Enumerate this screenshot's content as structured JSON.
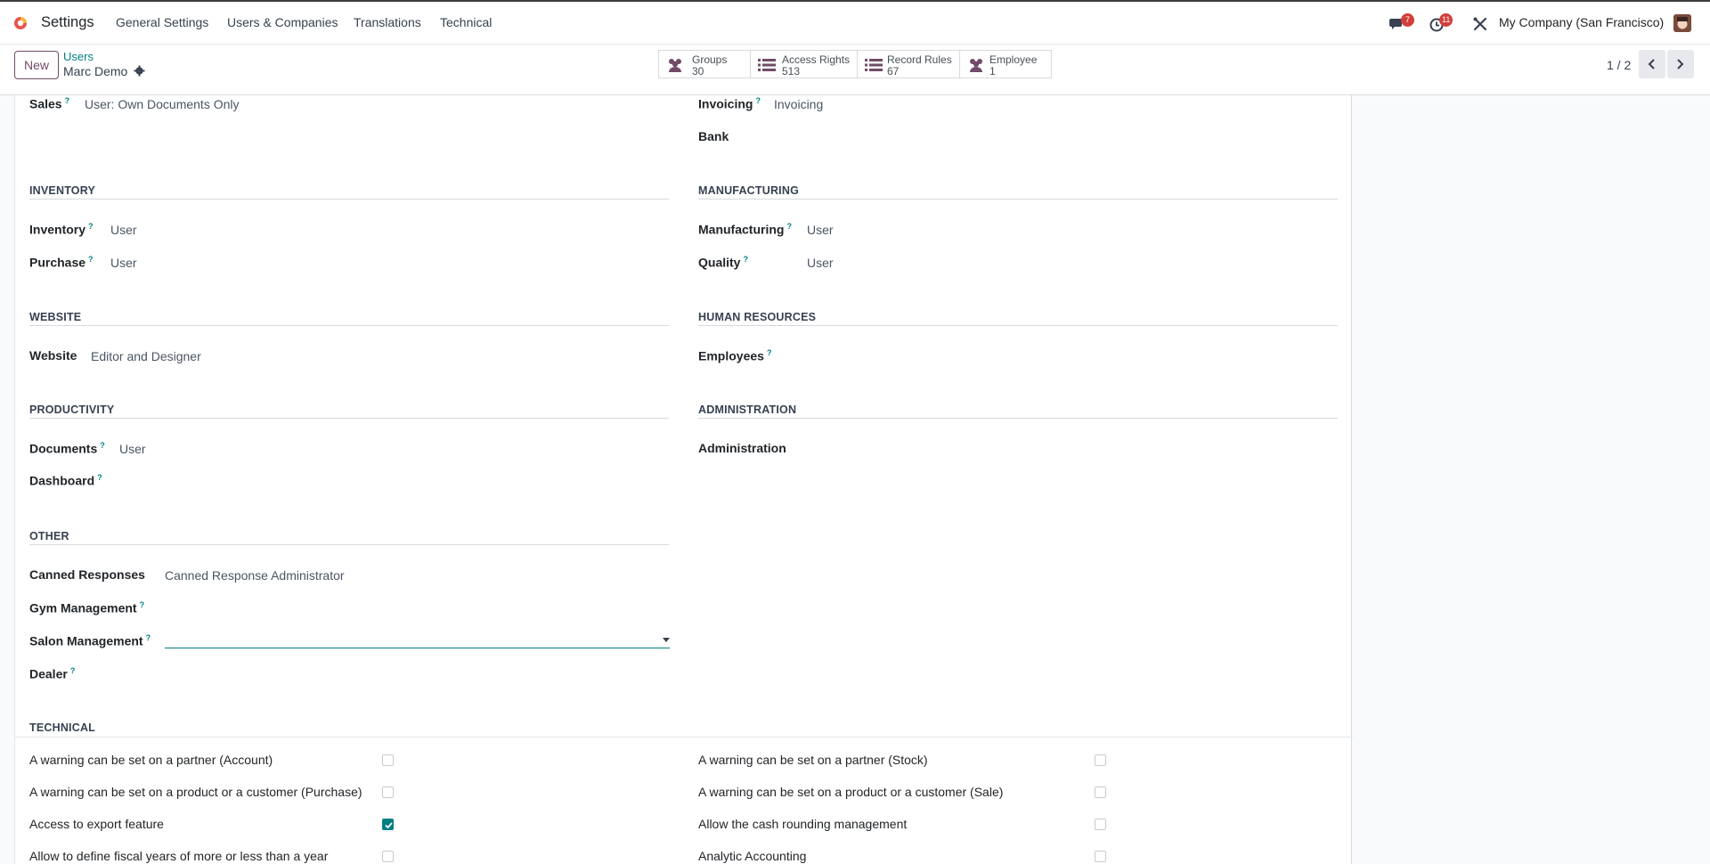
{
  "topbar": {
    "app_name": "Settings",
    "menu": [
      "General Settings",
      "Users & Companies",
      "Translations",
      "Technical"
    ],
    "messages_badge": "7",
    "activities_badge": "11",
    "company": "My Company (San Francisco)"
  },
  "control": {
    "new_label": "New",
    "breadcrumb_parent": "Users",
    "breadcrumb_current": "Marc Demo",
    "stats": [
      {
        "label": "Groups",
        "value": "30",
        "icon": "users-icon"
      },
      {
        "label": "Access Rights",
        "value": "513",
        "icon": "list-icon"
      },
      {
        "label": "Record Rules",
        "value": "67",
        "icon": "list-icon"
      },
      {
        "label": "Employee",
        "value": "1",
        "icon": "users-icon"
      }
    ],
    "pager": "1 / 2"
  },
  "form": {
    "sales": {
      "label": "Sales",
      "value": "User: Own Documents Only"
    },
    "invoicing": {
      "label": "Invoicing",
      "value": "Invoicing"
    },
    "bank": {
      "label": "Bank"
    },
    "inventory_section": "INVENTORY",
    "inventory": {
      "label": "Inventory",
      "value": "User"
    },
    "purchase": {
      "label": "Purchase",
      "value": "User"
    },
    "manufacturing_section": "MANUFACTURING",
    "manufacturing": {
      "label": "Manufacturing",
      "value": "User"
    },
    "quality": {
      "label": "Quality",
      "value": "User"
    },
    "website_section": "WEBSITE",
    "website": {
      "label": "Website",
      "value": "Editor and Designer"
    },
    "hr_section": "HUMAN RESOURCES",
    "employees": {
      "label": "Employees"
    },
    "productivity_section": "PRODUCTIVITY",
    "documents": {
      "label": "Documents",
      "value": "User"
    },
    "dashboard": {
      "label": "Dashboard"
    },
    "administration_section": "ADMINISTRATION",
    "administration": {
      "label": "Administration"
    },
    "other_section": "OTHER",
    "canned": {
      "label": "Canned Responses",
      "value": "Canned Response Administrator"
    },
    "gym": {
      "label": "Gym Management"
    },
    "salon": {
      "label": "Salon Management",
      "value": ""
    },
    "dealer": {
      "label": "Dealer"
    },
    "technical_section": "TECHNICAL",
    "technical": [
      {
        "label": "A warning can be set on a partner (Account)",
        "checked": false
      },
      {
        "label": "A warning can be set on a partner (Stock)",
        "checked": false
      },
      {
        "label": "A warning can be set on a product or a customer (Purchase)",
        "checked": false
      },
      {
        "label": "A warning can be set on a product or a customer (Sale)",
        "checked": false
      },
      {
        "label": "Access to export feature",
        "checked": true
      },
      {
        "label": "Allow the cash rounding management",
        "checked": false
      },
      {
        "label": "Allow to define fiscal years of more or less than a year",
        "checked": false
      },
      {
        "label": "Analytic Accounting",
        "checked": false
      }
    ]
  },
  "colors": {
    "brand": "#714b67",
    "accent": "#017e84",
    "badge": "#d23f3a"
  }
}
